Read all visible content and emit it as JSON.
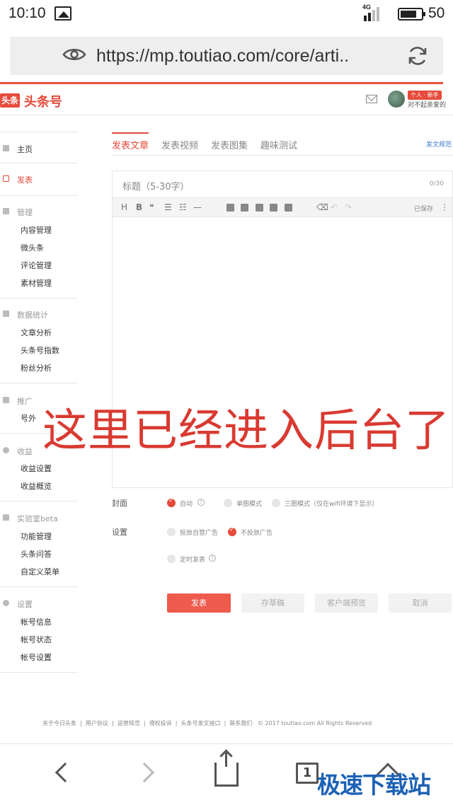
{
  "status_bar": {
    "time": "10:10",
    "network": "4G",
    "battery": "50"
  },
  "browser": {
    "url": "https://mp.toutiao.com/core/arti.."
  },
  "site": {
    "logo_box": "头条",
    "logo_text": "头条号",
    "user_badge": "个人 · 新手",
    "user_name": "对不起亲爱的"
  },
  "sidebar": {
    "home": "主页",
    "publish": "发表",
    "manage": {
      "head": "管理",
      "items": [
        "内容管理",
        "微头条",
        "评论管理",
        "素材管理"
      ]
    },
    "stats": {
      "head": "数据统计",
      "items": [
        "文章分析",
        "头条号指数",
        "粉丝分析"
      ]
    },
    "promo": {
      "head": "推广",
      "items": [
        "号外"
      ]
    },
    "income": {
      "head": "收益",
      "items": [
        "收益设置",
        "收益概览"
      ]
    },
    "lab": {
      "head": "实验室beta",
      "items": [
        "功能管理",
        "头条问答",
        "自定义菜单"
      ]
    },
    "settings": {
      "head": "设置",
      "items": [
        "帐号信息",
        "帐号状态",
        "帐号设置"
      ]
    }
  },
  "tabs": [
    "发表文章",
    "发表视频",
    "发表图集",
    "趣味测试"
  ],
  "rules_link": "发文规范",
  "editor": {
    "title_placeholder": "标题（5-30字）",
    "title_count": "0/30",
    "toolbar": [
      "H",
      "B",
      "❝",
      "☰",
      "☷",
      "—"
    ],
    "saved": "已保存",
    "more": "⋮"
  },
  "overlay_text": "这里已经进入后台了",
  "form": {
    "cover_label": "封面",
    "cover_options": [
      "自动",
      "单图模式",
      "三图模式（仅在wifi环境下显示）"
    ],
    "settings_label": "设置",
    "ad_options": [
      "投放自营广告",
      "不投放广告"
    ],
    "scheduled": "定时发表"
  },
  "buttons": {
    "publish": "发表",
    "draft": "存草稿",
    "preview": "客户端预览",
    "cancel": "取消"
  },
  "footer": {
    "links": [
      "关于今日头条",
      "用户协议",
      "运营规范",
      "侵权投诉",
      "头条号发文接口",
      "联系我们"
    ],
    "copyright": "© 2017 toutiao.com All Rights Reserved"
  },
  "nav": {
    "tabs_count": "1"
  },
  "watermark": "极速下载站",
  "colors": {
    "accent": "#e64a3b",
    "link": "#3a77c9"
  }
}
